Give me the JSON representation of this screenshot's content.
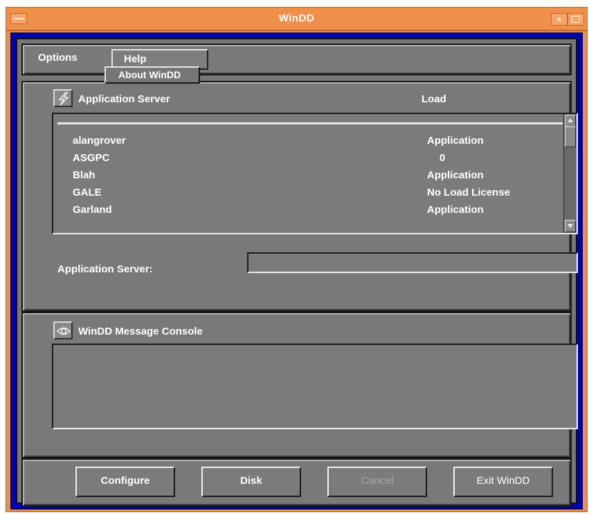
{
  "window": {
    "title": "WinDD"
  },
  "menubar": {
    "options_label": "Options",
    "help_label": "Help",
    "help_menu_items": [
      "About WinDD"
    ]
  },
  "server_panel": {
    "heading": "Application Server",
    "load_heading": "Load",
    "icon": "lightning-bolt-icon",
    "rows": [
      {
        "name": "alangrover",
        "load": "Application"
      },
      {
        "name": "ASGPC",
        "load": "0"
      },
      {
        "name": "Blah",
        "load": "Application"
      },
      {
        "name": "GALE",
        "load": "No Load License"
      },
      {
        "name": "Garland",
        "load": "Application"
      }
    ],
    "field_label": "Application Server:",
    "field_value": ""
  },
  "console_panel": {
    "heading": "WinDD Message Console",
    "icon": "console-eye-icon",
    "messages": ""
  },
  "buttons": {
    "configure": "Configure",
    "disk": "Disk",
    "cancel": "Cancel",
    "exit": "Exit WinDD"
  },
  "colors": {
    "title_bar": "#f08f4a",
    "frame": "#0000b4",
    "panel": "#797979"
  }
}
